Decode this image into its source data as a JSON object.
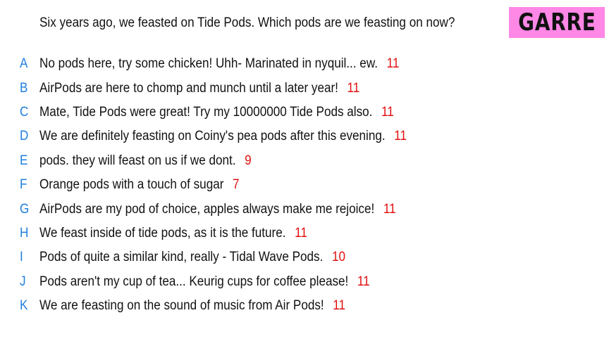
{
  "question": "Six years ago, we feasted on Tide Pods. Which pods are we feasting on now?",
  "player_name": "GARRE",
  "colors": {
    "letter": "#1f7fe0",
    "score": "#e01010",
    "badge_background": "#ff87e6",
    "text": "#111111"
  },
  "answers": [
    {
      "letter": "A",
      "text": "No pods here, try some chicken! Uhh- Marinated in nyquil... ew.",
      "score": "11"
    },
    {
      "letter": "B",
      "text": "AirPods are here to chomp and munch until a later year!",
      "score": "11"
    },
    {
      "letter": "C",
      "text": "Mate, Tide Pods were great! Try my 10000000 Tide Pods also.",
      "score": "11"
    },
    {
      "letter": "D",
      "text": "We are definitely feasting on Coiny's pea pods after this evening.",
      "score": "11"
    },
    {
      "letter": "E",
      "text": "pods. they will feast on us if we dont.",
      "score": "9"
    },
    {
      "letter": "F",
      "text": "Orange pods with a touch of sugar",
      "score": "7"
    },
    {
      "letter": "G",
      "text": "AirPods are my pod of choice, apples always make me rejoice!",
      "score": "11"
    },
    {
      "letter": "H",
      "text": "We feast inside of tide pods, as it is the future.",
      "score": "11"
    },
    {
      "letter": "I",
      "text": "Pods of quite a similar kind, really - Tidal Wave Pods.",
      "score": "10"
    },
    {
      "letter": "J",
      "text": "Pods aren't my cup of tea... Keurig cups for coffee please!",
      "score": "11"
    },
    {
      "letter": "K",
      "text": "We are feasting on the sound of music from Air Pods!",
      "score": "11"
    }
  ]
}
